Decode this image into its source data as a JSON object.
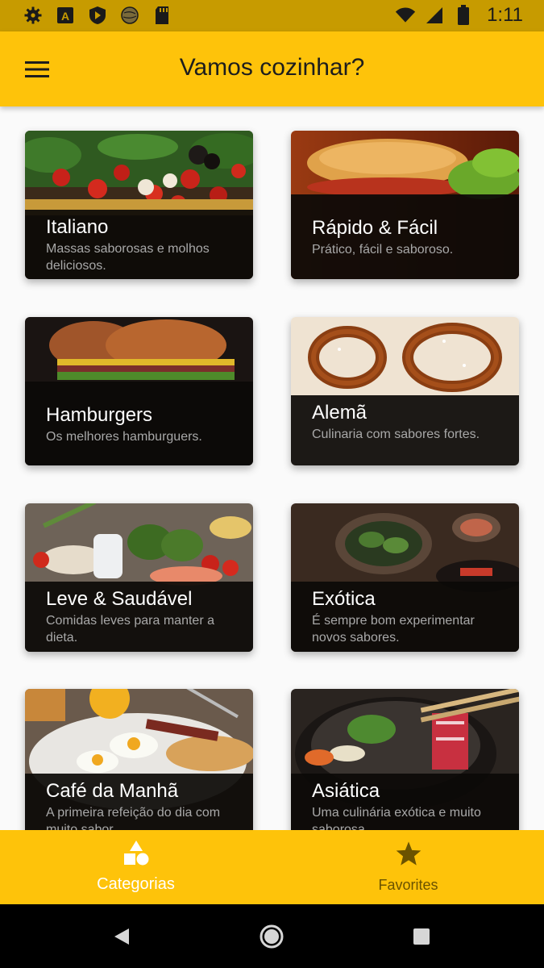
{
  "status_bar": {
    "time": "1:11",
    "left_icons": [
      "gear-icon",
      "a-box-icon",
      "shield-icon",
      "globe-icon",
      "sd-card-icon"
    ],
    "right_icons": [
      "wifi-icon",
      "signal-icon",
      "battery-icon"
    ]
  },
  "app_bar": {
    "title": "Vamos cozinhar?",
    "menu_icon": "hamburger-menu-icon"
  },
  "categories": [
    {
      "title": "Italiano",
      "subtitle": "Massas saborosas e molhos deliciosos.",
      "image": "tomatoes-vegetables-photo"
    },
    {
      "title": "Rápido & Fácil",
      "subtitle": "Prático, fácil e saboroso.",
      "image": "sandwich-photo"
    },
    {
      "title": "Hamburgers",
      "subtitle": "Os melhores hamburguers.",
      "image": "burgers-photo"
    },
    {
      "title": "Alemã",
      "subtitle": "Culinaria com sabores fortes.",
      "image": "pretzels-photo"
    },
    {
      "title": "Leve & Saudável",
      "subtitle": "Comidas leves para manter a dieta.",
      "image": "healthy-food-photo"
    },
    {
      "title": "Exótica",
      "subtitle": "É sempre bom experimentar novos sabores.",
      "image": "exotic-dishes-photo"
    },
    {
      "title": "Café da Manhã",
      "subtitle": "A primeira refeição do dia com muito sabor.",
      "image": "breakfast-photo"
    },
    {
      "title": "Asiática",
      "subtitle": "Uma culinária exótica e muito saborosa..",
      "image": "asian-hotpot-photo"
    }
  ],
  "bottom_nav": {
    "items": [
      {
        "label": "Categorias",
        "icon": "categories-shapes-icon",
        "active": true
      },
      {
        "label": "Favorites",
        "icon": "star-icon",
        "active": false
      }
    ]
  },
  "colors": {
    "primary": "#fec30a",
    "status_bar": "#c79b00",
    "card_panel": "#0c0a08",
    "subtitle": "#a8a8a8"
  }
}
